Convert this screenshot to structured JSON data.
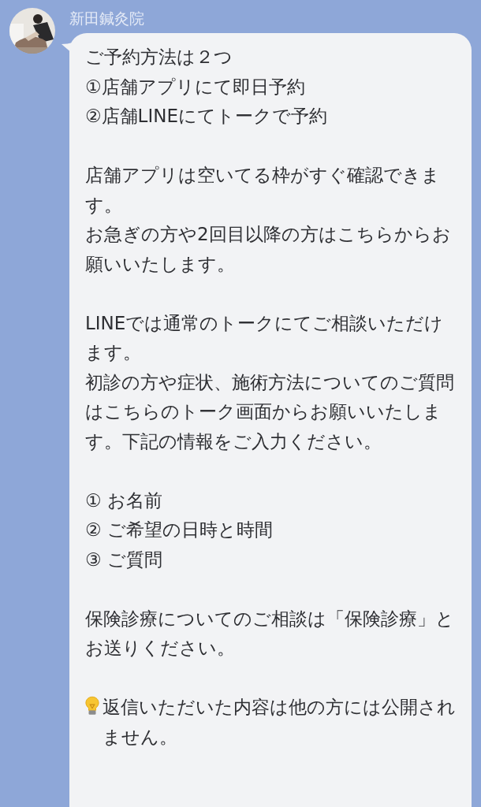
{
  "chat": {
    "sender": "新田鍼灸院",
    "message": {
      "paragraphs": [
        {
          "kind": "text",
          "lines": [
            "ご予約方法は２つ",
            "①店舗アプリにて即日予約",
            "②店舗LINEにてトークで予約"
          ]
        },
        {
          "kind": "text",
          "lines": [
            "店舗アプリは空いてる枠がすぐ確認できます。",
            "お急ぎの方や2回目以降の方はこちらからお願いいたします。"
          ]
        },
        {
          "kind": "text",
          "lines": [
            "LINEでは通常のトークにてご相談いただけます。",
            "初診の方や症状、施術方法についてのご質問はこちらのトーク画面からお願いいたします。下記の情報をご入力ください。"
          ]
        },
        {
          "kind": "text",
          "lines": [
            "① お名前",
            "② ご希望の日時と時間",
            "③ ご質問"
          ]
        },
        {
          "kind": "text",
          "lines": [
            "保険診療についてのご相談は「保険診療」とお送りください。"
          ]
        },
        {
          "kind": "tip",
          "text": "返信いただいた内容は他の方には公開されません。"
        }
      ]
    }
  }
}
